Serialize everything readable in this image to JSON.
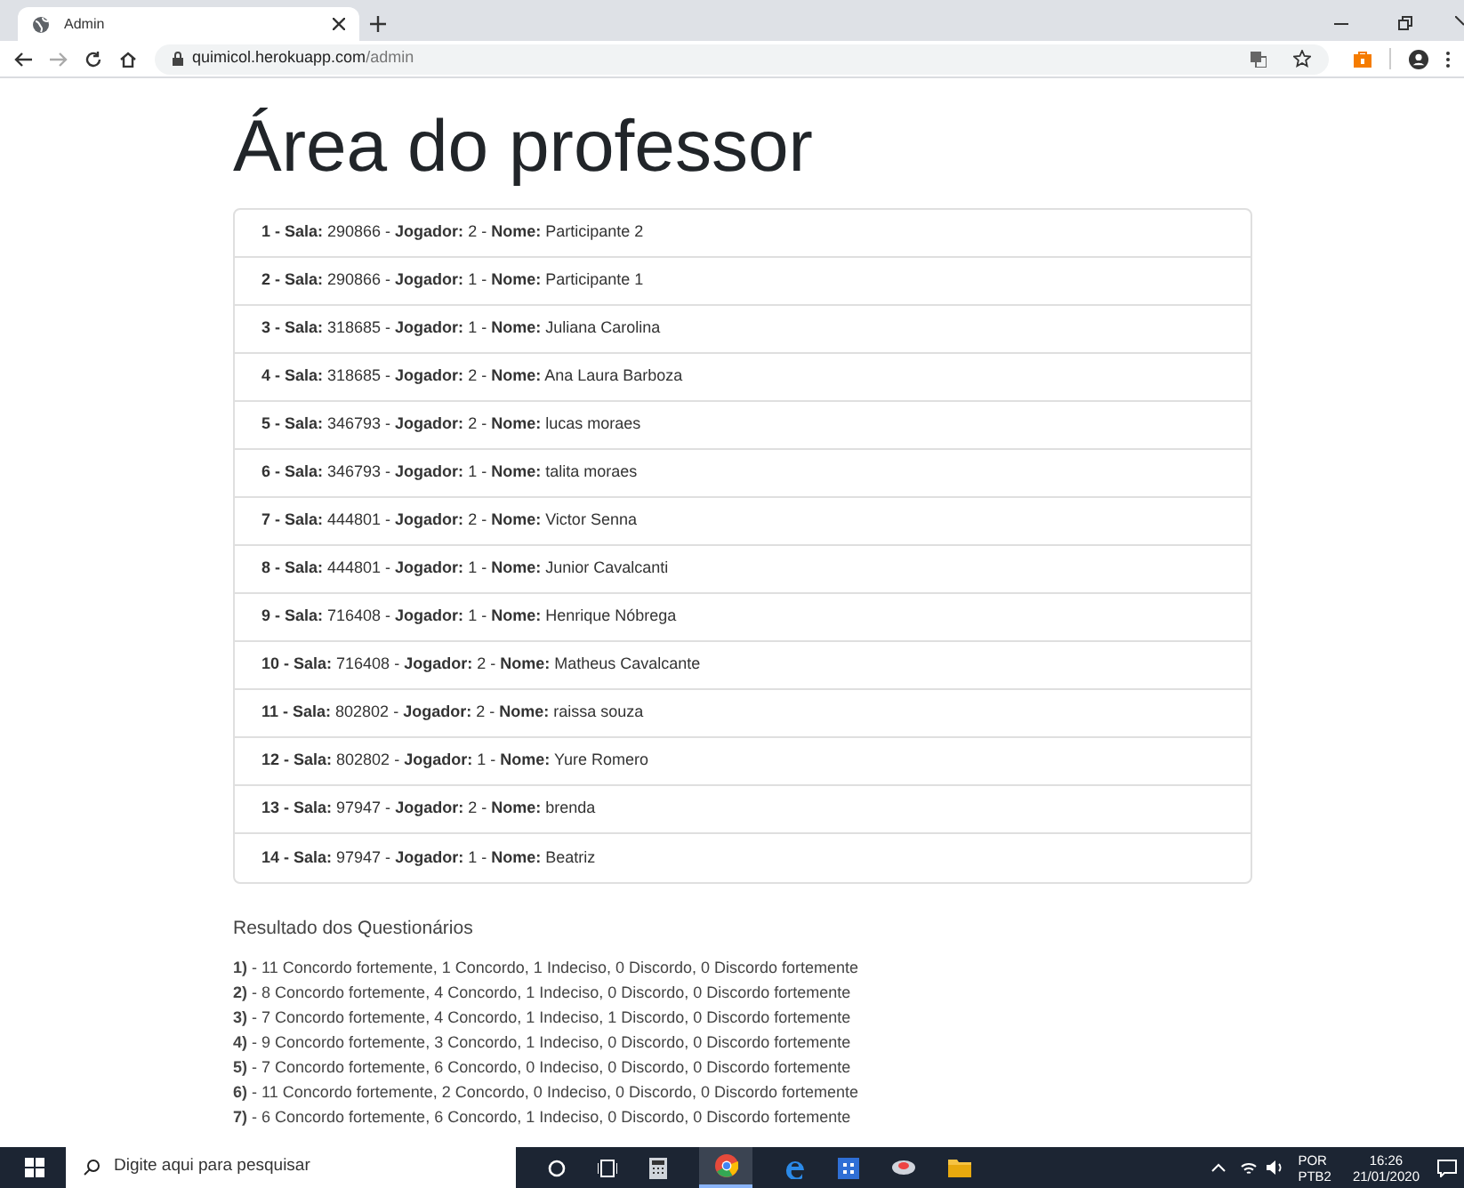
{
  "browser": {
    "tab_title": "Admin",
    "url_host": "quimicol.herokuapp.com",
    "url_path": "/admin"
  },
  "heading": "Área do professor",
  "players": [
    "**1 - Sala:** 290866 - **Jogador:** 2 - **Nome:** Participante 2",
    "**2 - Sala:** 290866 - **Jogador:** 1 - **Nome:** Participante 1",
    "**3 - Sala:** 318685 - **Jogador:** 1 - **Nome:** Juliana Carolina",
    "**4 - Sala:** 318685 - **Jogador:** 2 - **Nome:** Ana Laura Barboza",
    "**5 - Sala:** 346793 - **Jogador:** 2 - **Nome:** lucas moraes",
    "**6 - Sala:** 346793 - **Jogador:** 1 - **Nome:** talita moraes",
    "**7 - Sala:** 444801 - **Jogador:** 2 - **Nome:** Victor Senna",
    "**8 - Sala:** 444801 - **Jogador:** 1 - **Nome:** Junior Cavalcanti",
    "**9 - Sala:** 716408 - **Jogador:** 1 - **Nome:** Henrique Nóbrega",
    "**10 - Sala:** 716408 - **Jogador:** 2 - **Nome:** Matheus Cavalcante",
    "**11 - Sala:** 802802 - **Jogador:** 2 - **Nome:** raissa souza",
    "**12 - Sala:** 802802 - **Jogador:** 1 - **Nome:** Yure Romero",
    "**13 - Sala:** 97947 - **Jogador:** 2 - **Nome:** brenda",
    "**14 - Sala:** 97947 - **Jogador:** 1 - **Nome:** Beatriz"
  ],
  "results_title": "Resultado dos Questionários",
  "results": [
    "**1)** - 11 Concordo fortemente, 1 Concordo, 1 Indeciso, 0 Discordo, 0 Discordo fortemente",
    "**2)** - 8 Concordo fortemente, 4 Concordo, 1 Indeciso, 0 Discordo, 0 Discordo fortemente",
    "**3)** - 7 Concordo fortemente, 4 Concordo, 1 Indeciso, 1 Discordo, 0 Discordo fortemente",
    "**4)** - 9 Concordo fortemente, 3 Concordo, 1 Indeciso, 0 Discordo, 0 Discordo fortemente",
    "**5)** - 7 Concordo fortemente, 6 Concordo, 0 Indeciso, 0 Discordo, 0 Discordo fortemente",
    "**6)** - 11 Concordo fortemente, 2 Concordo, 0 Indeciso, 0 Discordo, 0 Discordo fortemente",
    "**7)** - 6 Concordo fortemente, 6 Concordo, 1 Indeciso, 0 Discordo, 0 Discordo fortemente"
  ],
  "taskbar": {
    "search_placeholder": "Digite aqui para pesquisar",
    "language": "POR",
    "layout": "PTB2",
    "time": "16:26",
    "date": "21/01/2020"
  }
}
